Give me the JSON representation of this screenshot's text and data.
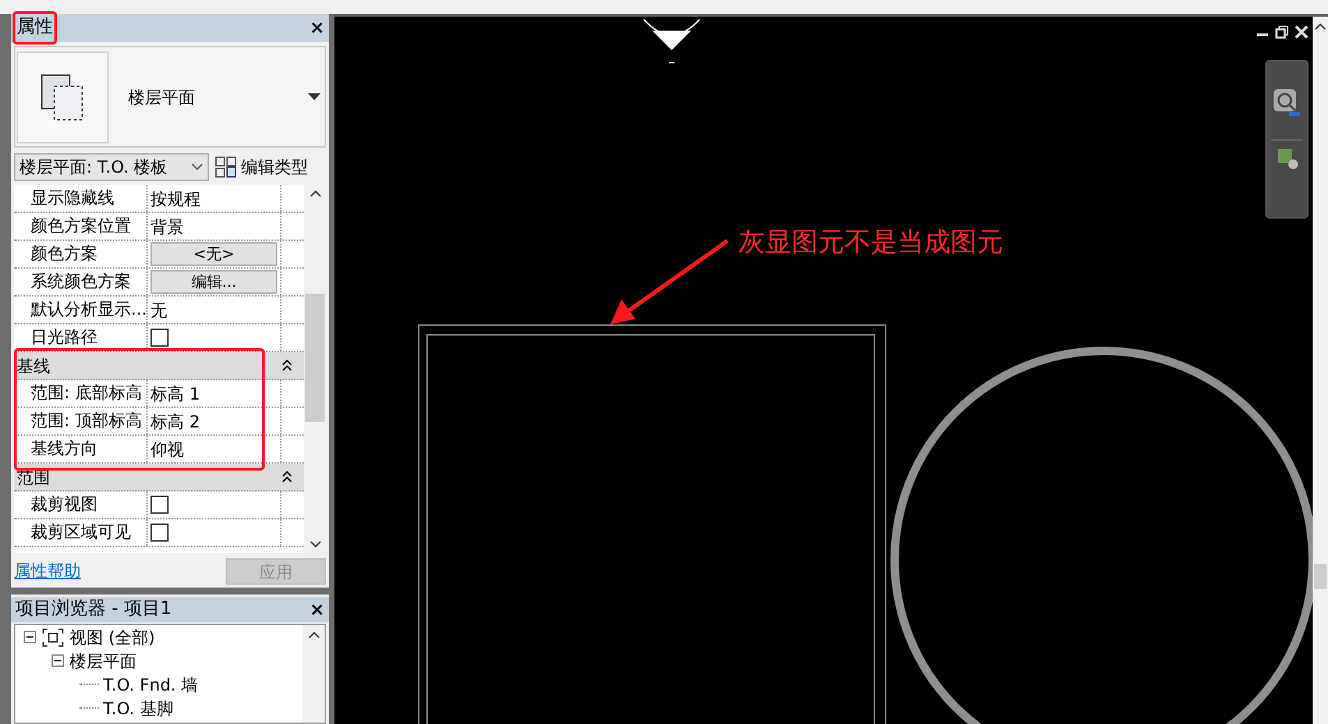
{
  "properties_panel": {
    "title": "属性",
    "close": "×",
    "type_name": "楼层平面",
    "view_selector": "楼层平面: T.O. 楼板",
    "edit_type": "编辑类型",
    "rows": [
      {
        "kind": "text",
        "label": "显示隐藏线",
        "value": "按规程"
      },
      {
        "kind": "text",
        "label": "颜色方案位置",
        "value": "背景"
      },
      {
        "kind": "button",
        "label": "颜色方案",
        "value": "<无>"
      },
      {
        "kind": "button",
        "label": "系统颜色方案",
        "value": "编辑..."
      },
      {
        "kind": "text",
        "label": "默认分析显示...",
        "value": "无"
      },
      {
        "kind": "checkbox",
        "label": "日光路径",
        "checked": false
      },
      {
        "kind": "group",
        "label": "基线",
        "expanded": true
      },
      {
        "kind": "text",
        "label": "范围: 底部标高",
        "value": "标高 1"
      },
      {
        "kind": "text",
        "label": "范围: 顶部标高",
        "value": "标高 2"
      },
      {
        "kind": "text",
        "label": "基线方向",
        "value": "仰视"
      },
      {
        "kind": "group",
        "label": "范围",
        "expanded": true
      },
      {
        "kind": "checkbox",
        "label": "裁剪视图",
        "checked": false
      },
      {
        "kind": "checkbox",
        "label": "裁剪区域可见",
        "checked": false
      }
    ],
    "help_link": "属性帮助",
    "apply_button": {
      "label": "应用",
      "disabled": true
    }
  },
  "project_browser": {
    "title": "项目浏览器 - 项目1",
    "close": "×",
    "tree": [
      {
        "label": "视图 (全部)",
        "expanded": true,
        "children": [
          {
            "label": "楼层平面",
            "expanded": true,
            "children": [
              {
                "label": "T.O. Fnd. 墙"
              },
              {
                "label": "T.O. 基脚"
              }
            ]
          }
        ]
      }
    ]
  },
  "annotation": {
    "text": "灰显图元不是当成图元"
  }
}
